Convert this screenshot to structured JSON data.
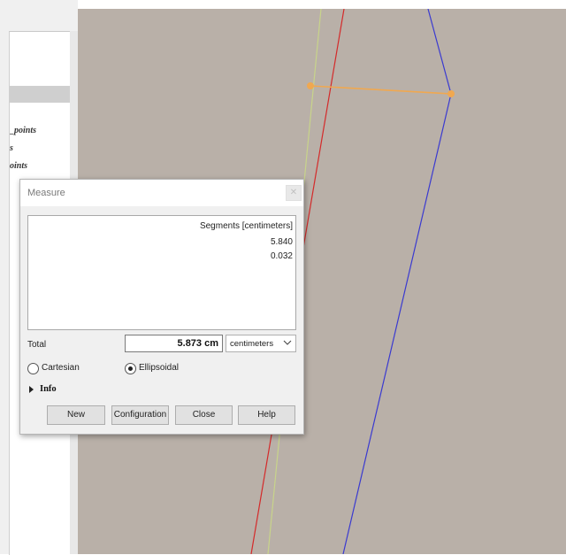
{
  "layers_panel": {
    "labels": [
      "_points",
      "s",
      "oints"
    ]
  },
  "measure": {
    "title": "Measure",
    "segments_header": "Segments [centimeters]",
    "segments": [
      "5.840",
      "0.032"
    ],
    "total_label": "Total",
    "total_value": "5.873 cm",
    "units_selected": "centimeters",
    "radio_cartesian": "Cartesian",
    "radio_ellipsoidal": "Ellipsoidal",
    "selected_mode": "Ellipsoidal",
    "info_label": "Info",
    "buttons": {
      "new": "New",
      "configuration": "Configuration",
      "close": "Close",
      "help": "Help"
    }
  },
  "colors": {
    "map_background": "#b9b0a8",
    "red_line": "#d42a2a",
    "yellow_line": "#c8d48a",
    "blue_line": "#3a3ad0",
    "measure_line": "#f0a850"
  }
}
